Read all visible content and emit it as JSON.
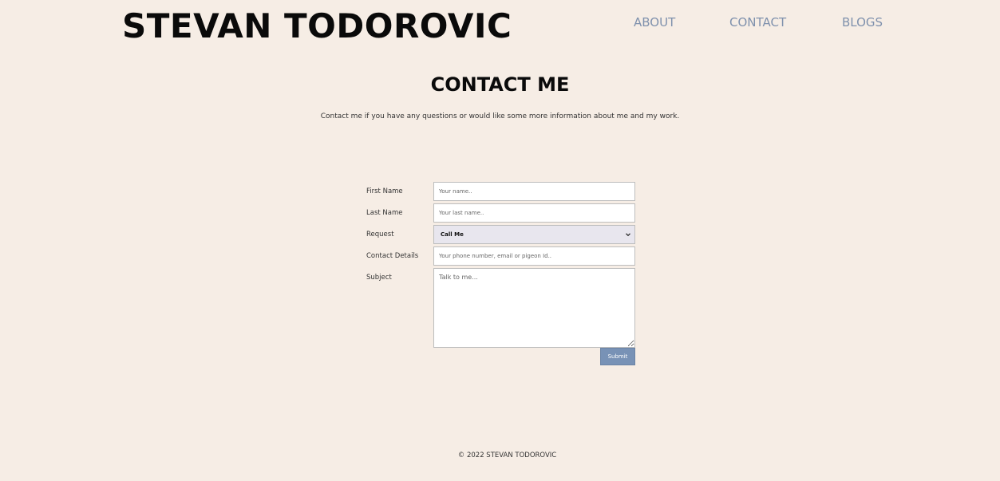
{
  "header": {
    "brand": "STEVAN TODOROVIC",
    "nav": {
      "about": "ABOUT",
      "contact": "CONTACT",
      "blogs": "BLOGS"
    }
  },
  "main": {
    "title": "CONTACT ME",
    "intro": "Contact me if you have any questions or would like some more information about me and my work."
  },
  "form": {
    "first_name": {
      "label": "First Name",
      "placeholder": "Your name.."
    },
    "last_name": {
      "label": "Last Name",
      "placeholder": "Your last name.."
    },
    "request": {
      "label": "Request",
      "selected": "Call Me"
    },
    "contact_details": {
      "label": "Contact Details",
      "placeholder": "Your phone number, email or pigeon Id.."
    },
    "subject": {
      "label": "Subject",
      "placeholder": "Talk to me..."
    },
    "submit_label": "Submit"
  },
  "footer": {
    "text": "© 2022 STEVAN TODOROVIC"
  },
  "colors": {
    "background": "#f6ede5",
    "nav_link": "#7f91ad",
    "button": "#7892b6"
  }
}
